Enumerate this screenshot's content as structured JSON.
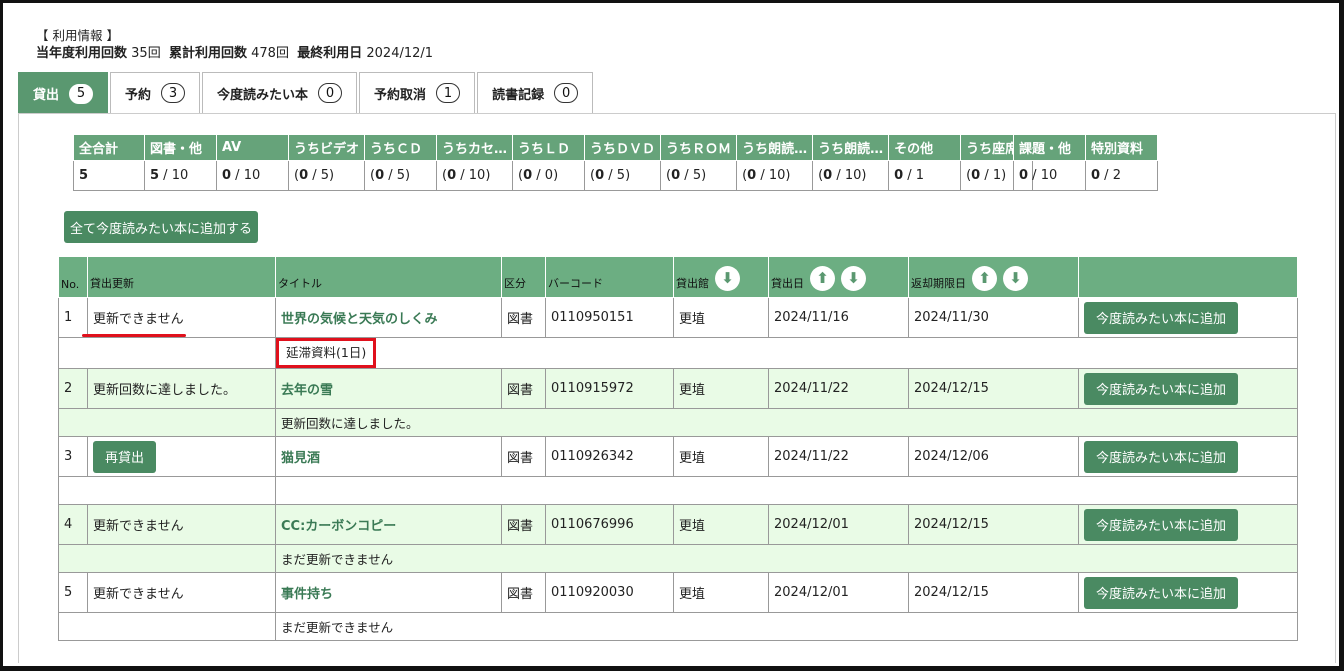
{
  "usage": {
    "heading": "【 利用情報 】",
    "year_label": "当年度利用回数",
    "year_value": "35回",
    "total_label": "累計利用回数",
    "total_value": "478回",
    "last_label": "最終利用日",
    "last_value": "2024/12/1"
  },
  "tabs": [
    {
      "label": "貸出",
      "count": "5"
    },
    {
      "label": "予約",
      "count": "3"
    },
    {
      "label": "今度読みたい本",
      "count": "0"
    },
    {
      "label": "予約取消",
      "count": "1"
    },
    {
      "label": "読書記録",
      "count": "0"
    }
  ],
  "summary": {
    "headers": [
      "全合計",
      "図書・他",
      "AV",
      "うちビデオ",
      "うちＣＤ",
      "うちカセ…",
      "うちＬＤ",
      "うちＤＶＤ",
      "うちＲＯＭ",
      "うち朗読…",
      "うち朗読…",
      "その他",
      "うち座席"
    ],
    "cells": [
      {
        "pre": "",
        "bold": "5",
        "post": ""
      },
      {
        "pre": "",
        "bold": "5",
        "post": " / 10"
      },
      {
        "pre": "",
        "bold": "0",
        "post": " / 10"
      },
      {
        "pre": "(",
        "bold": "0",
        "post": " / 5)"
      },
      {
        "pre": "(",
        "bold": "0",
        "post": " / 5)"
      },
      {
        "pre": "(",
        "bold": "0",
        "post": " / 10)"
      },
      {
        "pre": "(",
        "bold": "0",
        "post": " / 0)"
      },
      {
        "pre": "(",
        "bold": "0",
        "post": " / 5)"
      },
      {
        "pre": "(",
        "bold": "0",
        "post": " / 5)"
      },
      {
        "pre": "(",
        "bold": "0",
        "post": " / 10)"
      },
      {
        "pre": "(",
        "bold": "0",
        "post": " / 10)"
      },
      {
        "pre": "",
        "bold": "0",
        "post": " / 1"
      },
      {
        "pre": "(",
        "bold": "0",
        "post": " / 1)"
      }
    ],
    "extra_headers": [
      "課題・他",
      "特別資料"
    ],
    "extra_cells": [
      {
        "pre": "",
        "bold": "0",
        "post": " / 10"
      },
      {
        "pre": "",
        "bold": "0",
        "post": " / 2"
      }
    ]
  },
  "add_all_label": "全て今度読みたい本に追加する",
  "loans": {
    "headers": {
      "no": "No.",
      "renew": "貸出更新",
      "title": "タイトル",
      "type": "区分",
      "barcode": "バーコード",
      "library": "貸出館",
      "loan_date": "貸出日",
      "due_date": "返却期限日"
    },
    "add_label": "今度読みたい本に追加",
    "rows": [
      {
        "no": "1",
        "renew": "更新できません",
        "title": "世界の気候と天気のしくみ",
        "type": "図書",
        "barcode": "0110950151",
        "library": "更埴",
        "loan": "2024/11/16",
        "due": "2024/11/30",
        "note": "延滞資料(1日)"
      },
      {
        "no": "2",
        "renew": "更新回数に達しました。",
        "title": "去年の雪",
        "type": "図書",
        "barcode": "0110915972",
        "library": "更埴",
        "loan": "2024/11/22",
        "due": "2024/12/15",
        "note": "更新回数に達しました。"
      },
      {
        "no": "3",
        "renew": "再貸出",
        "title": "猫見酒",
        "type": "図書",
        "barcode": "0110926342",
        "library": "更埴",
        "loan": "2024/11/22",
        "due": "2024/12/06",
        "note": ""
      },
      {
        "no": "4",
        "renew": "更新できません",
        "title": "CC:カーボンコピー",
        "type": "図書",
        "barcode": "0110676996",
        "library": "更埴",
        "loan": "2024/12/01",
        "due": "2024/12/15",
        "note": "まだ更新できません"
      },
      {
        "no": "5",
        "renew": "更新できません",
        "title": "事件持ち",
        "type": "図書",
        "barcode": "0110920030",
        "library": "更埴",
        "loan": "2024/12/01",
        "due": "2024/12/15",
        "note": "まだ更新できません"
      }
    ]
  },
  "colors": {
    "accent": "#5a9870",
    "row_alt": "#e9fbe6",
    "highlight": "#e0101c"
  }
}
